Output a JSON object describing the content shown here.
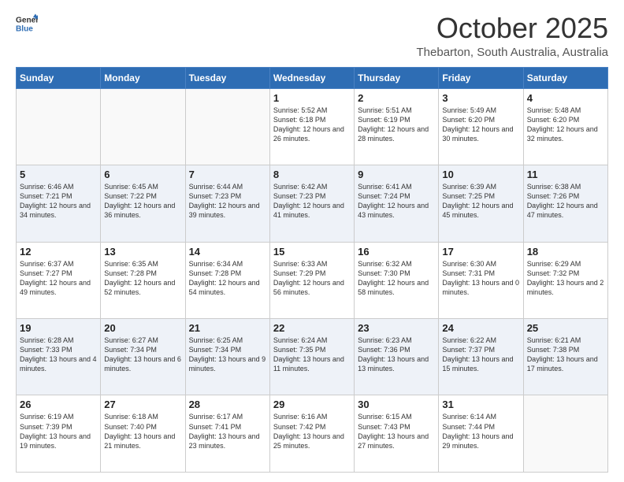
{
  "header": {
    "logo_line1": "General",
    "logo_line2": "Blue",
    "month": "October 2025",
    "location": "Thebarton, South Australia, Australia"
  },
  "days_of_week": [
    "Sunday",
    "Monday",
    "Tuesday",
    "Wednesday",
    "Thursday",
    "Friday",
    "Saturday"
  ],
  "weeks": [
    [
      {
        "day": "",
        "sunrise": "",
        "sunset": "",
        "daylight": ""
      },
      {
        "day": "",
        "sunrise": "",
        "sunset": "",
        "daylight": ""
      },
      {
        "day": "",
        "sunrise": "",
        "sunset": "",
        "daylight": ""
      },
      {
        "day": "1",
        "sunrise": "Sunrise: 5:52 AM",
        "sunset": "Sunset: 6:18 PM",
        "daylight": "Daylight: 12 hours and 26 minutes."
      },
      {
        "day": "2",
        "sunrise": "Sunrise: 5:51 AM",
        "sunset": "Sunset: 6:19 PM",
        "daylight": "Daylight: 12 hours and 28 minutes."
      },
      {
        "day": "3",
        "sunrise": "Sunrise: 5:49 AM",
        "sunset": "Sunset: 6:20 PM",
        "daylight": "Daylight: 12 hours and 30 minutes."
      },
      {
        "day": "4",
        "sunrise": "Sunrise: 5:48 AM",
        "sunset": "Sunset: 6:20 PM",
        "daylight": "Daylight: 12 hours and 32 minutes."
      }
    ],
    [
      {
        "day": "5",
        "sunrise": "Sunrise: 6:46 AM",
        "sunset": "Sunset: 7:21 PM",
        "daylight": "Daylight: 12 hours and 34 minutes."
      },
      {
        "day": "6",
        "sunrise": "Sunrise: 6:45 AM",
        "sunset": "Sunset: 7:22 PM",
        "daylight": "Daylight: 12 hours and 36 minutes."
      },
      {
        "day": "7",
        "sunrise": "Sunrise: 6:44 AM",
        "sunset": "Sunset: 7:23 PM",
        "daylight": "Daylight: 12 hours and 39 minutes."
      },
      {
        "day": "8",
        "sunrise": "Sunrise: 6:42 AM",
        "sunset": "Sunset: 7:23 PM",
        "daylight": "Daylight: 12 hours and 41 minutes."
      },
      {
        "day": "9",
        "sunrise": "Sunrise: 6:41 AM",
        "sunset": "Sunset: 7:24 PM",
        "daylight": "Daylight: 12 hours and 43 minutes."
      },
      {
        "day": "10",
        "sunrise": "Sunrise: 6:39 AM",
        "sunset": "Sunset: 7:25 PM",
        "daylight": "Daylight: 12 hours and 45 minutes."
      },
      {
        "day": "11",
        "sunrise": "Sunrise: 6:38 AM",
        "sunset": "Sunset: 7:26 PM",
        "daylight": "Daylight: 12 hours and 47 minutes."
      }
    ],
    [
      {
        "day": "12",
        "sunrise": "Sunrise: 6:37 AM",
        "sunset": "Sunset: 7:27 PM",
        "daylight": "Daylight: 12 hours and 49 minutes."
      },
      {
        "day": "13",
        "sunrise": "Sunrise: 6:35 AM",
        "sunset": "Sunset: 7:28 PM",
        "daylight": "Daylight: 12 hours and 52 minutes."
      },
      {
        "day": "14",
        "sunrise": "Sunrise: 6:34 AM",
        "sunset": "Sunset: 7:28 PM",
        "daylight": "Daylight: 12 hours and 54 minutes."
      },
      {
        "day": "15",
        "sunrise": "Sunrise: 6:33 AM",
        "sunset": "Sunset: 7:29 PM",
        "daylight": "Daylight: 12 hours and 56 minutes."
      },
      {
        "day": "16",
        "sunrise": "Sunrise: 6:32 AM",
        "sunset": "Sunset: 7:30 PM",
        "daylight": "Daylight: 12 hours and 58 minutes."
      },
      {
        "day": "17",
        "sunrise": "Sunrise: 6:30 AM",
        "sunset": "Sunset: 7:31 PM",
        "daylight": "Daylight: 13 hours and 0 minutes."
      },
      {
        "day": "18",
        "sunrise": "Sunrise: 6:29 AM",
        "sunset": "Sunset: 7:32 PM",
        "daylight": "Daylight: 13 hours and 2 minutes."
      }
    ],
    [
      {
        "day": "19",
        "sunrise": "Sunrise: 6:28 AM",
        "sunset": "Sunset: 7:33 PM",
        "daylight": "Daylight: 13 hours and 4 minutes."
      },
      {
        "day": "20",
        "sunrise": "Sunrise: 6:27 AM",
        "sunset": "Sunset: 7:34 PM",
        "daylight": "Daylight: 13 hours and 6 minutes."
      },
      {
        "day": "21",
        "sunrise": "Sunrise: 6:25 AM",
        "sunset": "Sunset: 7:34 PM",
        "daylight": "Daylight: 13 hours and 9 minutes."
      },
      {
        "day": "22",
        "sunrise": "Sunrise: 6:24 AM",
        "sunset": "Sunset: 7:35 PM",
        "daylight": "Daylight: 13 hours and 11 minutes."
      },
      {
        "day": "23",
        "sunrise": "Sunrise: 6:23 AM",
        "sunset": "Sunset: 7:36 PM",
        "daylight": "Daylight: 13 hours and 13 minutes."
      },
      {
        "day": "24",
        "sunrise": "Sunrise: 6:22 AM",
        "sunset": "Sunset: 7:37 PM",
        "daylight": "Daylight: 13 hours and 15 minutes."
      },
      {
        "day": "25",
        "sunrise": "Sunrise: 6:21 AM",
        "sunset": "Sunset: 7:38 PM",
        "daylight": "Daylight: 13 hours and 17 minutes."
      }
    ],
    [
      {
        "day": "26",
        "sunrise": "Sunrise: 6:19 AM",
        "sunset": "Sunset: 7:39 PM",
        "daylight": "Daylight: 13 hours and 19 minutes."
      },
      {
        "day": "27",
        "sunrise": "Sunrise: 6:18 AM",
        "sunset": "Sunset: 7:40 PM",
        "daylight": "Daylight: 13 hours and 21 minutes."
      },
      {
        "day": "28",
        "sunrise": "Sunrise: 6:17 AM",
        "sunset": "Sunset: 7:41 PM",
        "daylight": "Daylight: 13 hours and 23 minutes."
      },
      {
        "day": "29",
        "sunrise": "Sunrise: 6:16 AM",
        "sunset": "Sunset: 7:42 PM",
        "daylight": "Daylight: 13 hours and 25 minutes."
      },
      {
        "day": "30",
        "sunrise": "Sunrise: 6:15 AM",
        "sunset": "Sunset: 7:43 PM",
        "daylight": "Daylight: 13 hours and 27 minutes."
      },
      {
        "day": "31",
        "sunrise": "Sunrise: 6:14 AM",
        "sunset": "Sunset: 7:44 PM",
        "daylight": "Daylight: 13 hours and 29 minutes."
      },
      {
        "day": "",
        "sunrise": "",
        "sunset": "",
        "daylight": ""
      }
    ]
  ]
}
